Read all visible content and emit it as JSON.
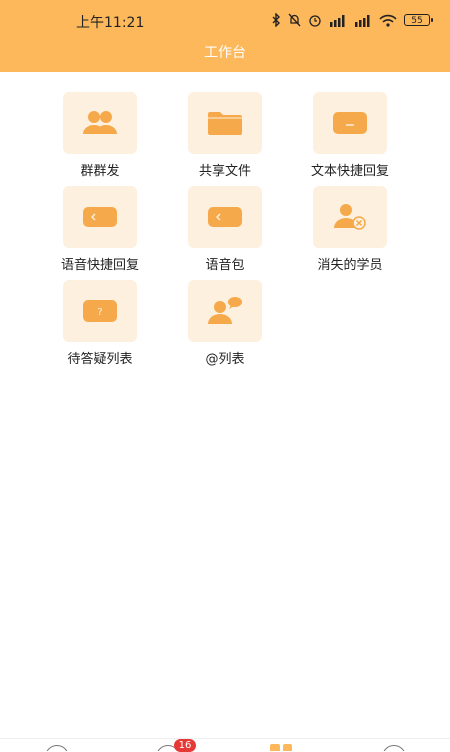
{
  "status_bar": {
    "time": "上午11:21",
    "battery": "55"
  },
  "header": {
    "title": "工作台"
  },
  "tiles": [
    {
      "label": "群群发",
      "icon": "group-users-icon"
    },
    {
      "label": "共享文件",
      "icon": "folder-icon"
    },
    {
      "label": "文本快捷回复",
      "icon": "text-reply-icon"
    },
    {
      "label": "语音快捷回复",
      "icon": "voice-reply-icon"
    },
    {
      "label": "语音包",
      "icon": "voice-pack-icon"
    },
    {
      "label": "消失的学员",
      "icon": "user-remove-icon"
    },
    {
      "label": "待答疑列表",
      "icon": "question-icon"
    },
    {
      "label": "@列表",
      "icon": "mention-user-icon"
    }
  ],
  "bottom_nav": {
    "badge": "16"
  },
  "colors": {
    "accent": "#fdb85b",
    "tile_bg": "#fdf0de",
    "icon": "#f5a94a"
  }
}
